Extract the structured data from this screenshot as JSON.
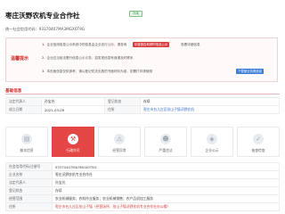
{
  "header": {
    "company_name": "枣庄沃野农机专业合作社",
    "status_badge": "存续",
    "credit_code_text": "统一社会信用代码：93370407MA3MGX0T9G"
  },
  "notice": {
    "label": "温馨提示",
    "rows": [
      {
        "num": "1.",
        "text": "企业信用信息公示系统中的信息由企业自行公示，请查询",
        "chip": "年度报告和即时信息公示",
        "chip_suffix": "查看详细信息"
      },
      {
        "num": "2.",
        "text": "企业应当依法履行信息公示义务，如发现信息有误请及时联系",
        "chip": ""
      },
      {
        "num": "3.",
        "text": "本页面信息仅供参考，请以登记机关出具的书面材料为准，如需打印请使用",
        "chip": "下载营业执照信息"
      }
    ]
  },
  "basic_info": {
    "section_title": "基础信息",
    "rows": [
      {
        "k1": "法定代表人",
        "v1": "孙宝光",
        "k2": "登记状态",
        "v2": "存续"
      },
      {
        "k1": "成立日期",
        "v1": "2021-03-09",
        "k2": "住所",
        "v2": "枣庄市台儿庄区张山子镇沃野农机"
      }
    ]
  },
  "tabs": [
    {
      "label": "基本信息",
      "icon": "document-icon",
      "glyph": "▤",
      "active": false
    },
    {
      "label": "行政许可",
      "icon": "hammer-icon",
      "glyph": "⚒",
      "active": true
    },
    {
      "label": "经营异常",
      "icon": "warning-icon",
      "glyph": "⚠",
      "active": false
    },
    {
      "label": "严重违法",
      "icon": "people-icon",
      "glyph": "☻",
      "active": false
    },
    {
      "label": "企业公示",
      "icon": "shield-icon",
      "glyph": "◈",
      "active": false
    },
    {
      "label": "抽查检查",
      "icon": "check-icon",
      "glyph": "✓",
      "active": false
    }
  ],
  "detail": {
    "rows": [
      {
        "k": "社会信用代码/注册号",
        "v": "93370407MA3MGX0T9G"
      },
      {
        "k": "企业名称",
        "v": "枣庄沃野农机专业合作社"
      },
      {
        "k": "法定代表人",
        "v": "孙宝光"
      },
      {
        "k": "登记状态",
        "v": "存续"
      },
      {
        "k": "经营范围",
        "v": "农业机械服务；农机作业服务；农业机械销售；农产品初加工服务"
      },
      {
        "k": "住所",
        "v": "枣庄市台儿庄区张山子镇（经营场所：张山子镇沃野农机专业合作社办公楼）"
      }
    ]
  },
  "colors": {
    "accent": "#e44545",
    "badge_green": "#3a9a4a",
    "link_blue": "#3a6fc4"
  }
}
